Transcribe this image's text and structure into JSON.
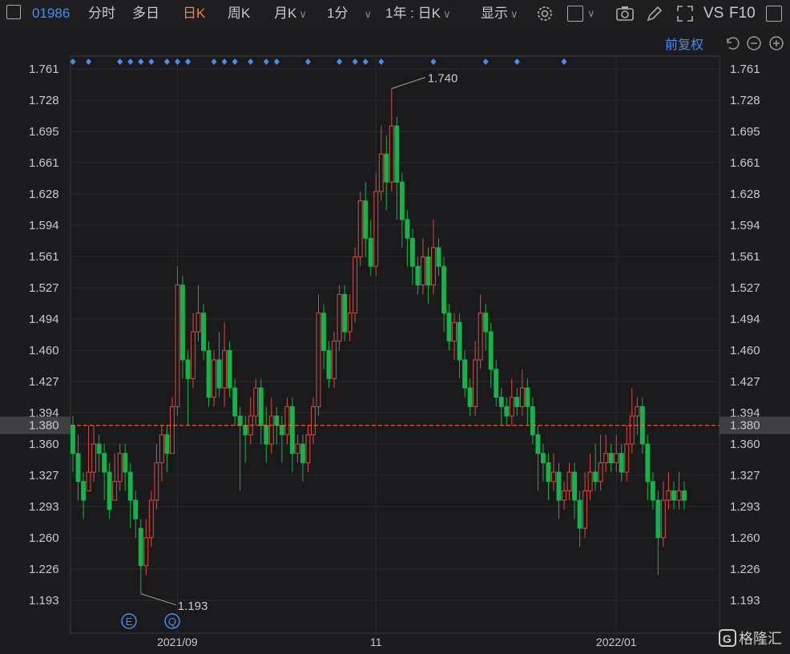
{
  "toolbar": {
    "code": "01986",
    "items": [
      "分时",
      "多日",
      "日K",
      "周K",
      "月K",
      "1分",
      "1年 : 日K",
      "显示"
    ],
    "active_item": "日K",
    "vs_label": "VS",
    "f10_label": "F10"
  },
  "adjust": {
    "label": "前复权"
  },
  "watermark": "格隆汇",
  "colors": {
    "up": "#e0493f",
    "down": "#16b24a",
    "marker": "#3f8dff",
    "current_price": "#ff5b4b",
    "accent": "#ff7a2e"
  },
  "event_markers": [
    "E",
    "Q"
  ],
  "chart_data": {
    "type": "candlestick",
    "y_ticks": [
      "1.761",
      "1.728",
      "1.695",
      "1.661",
      "1.628",
      "1.594",
      "1.561",
      "1.527",
      "1.494",
      "1.460",
      "1.427",
      "1.394",
      "1.360",
      "1.327",
      "1.293",
      "1.260",
      "1.226",
      "1.193"
    ],
    "ylim": [
      1.193,
      1.761
    ],
    "x_ticks": [
      "2021/09",
      "11",
      "2022/01"
    ],
    "current_price": "1.380",
    "max_label": "1.740",
    "min_label": "1.193",
    "candles": [
      [
        1.38,
        1.35,
        1.39,
        1.33
      ],
      [
        1.35,
        1.32,
        1.37,
        1.3
      ],
      [
        1.32,
        1.3,
        1.33,
        1.28
      ],
      [
        1.31,
        1.33,
        1.38,
        1.31
      ],
      [
        1.33,
        1.36,
        1.38,
        1.32
      ],
      [
        1.36,
        1.35,
        1.37,
        1.33
      ],
      [
        1.35,
        1.33,
        1.36,
        1.3
      ],
      [
        1.33,
        1.29,
        1.34,
        1.28
      ],
      [
        1.3,
        1.32,
        1.35,
        1.3
      ],
      [
        1.32,
        1.35,
        1.36,
        1.31
      ],
      [
        1.35,
        1.33,
        1.36,
        1.31
      ],
      [
        1.33,
        1.3,
        1.34,
        1.27
      ],
      [
        1.3,
        1.28,
        1.31,
        1.26
      ],
      [
        1.27,
        1.23,
        1.28,
        1.2
      ],
      [
        1.23,
        1.26,
        1.28,
        1.22
      ],
      [
        1.26,
        1.3,
        1.31,
        1.25
      ],
      [
        1.3,
        1.34,
        1.36,
        1.29
      ],
      [
        1.34,
        1.37,
        1.38,
        1.32
      ],
      [
        1.37,
        1.35,
        1.38,
        1.33
      ],
      [
        1.35,
        1.4,
        1.41,
        1.35
      ],
      [
        1.4,
        1.53,
        1.55,
        1.39
      ],
      [
        1.53,
        1.45,
        1.54,
        1.43
      ],
      [
        1.45,
        1.43,
        1.46,
        1.38
      ],
      [
        1.43,
        1.48,
        1.5,
        1.42
      ],
      [
        1.48,
        1.5,
        1.53,
        1.47
      ],
      [
        1.5,
        1.46,
        1.51,
        1.45
      ],
      [
        1.46,
        1.41,
        1.47,
        1.4
      ],
      [
        1.41,
        1.45,
        1.46,
        1.4
      ],
      [
        1.45,
        1.42,
        1.48,
        1.41
      ],
      [
        1.42,
        1.46,
        1.49,
        1.4
      ],
      [
        1.46,
        1.42,
        1.47,
        1.41
      ],
      [
        1.42,
        1.39,
        1.43,
        1.38
      ],
      [
        1.39,
        1.38,
        1.4,
        1.31
      ],
      [
        1.38,
        1.37,
        1.39,
        1.34
      ],
      [
        1.37,
        1.39,
        1.41,
        1.36
      ],
      [
        1.39,
        1.42,
        1.43,
        1.38
      ],
      [
        1.42,
        1.38,
        1.43,
        1.36
      ],
      [
        1.38,
        1.36,
        1.4,
        1.34
      ],
      [
        1.36,
        1.39,
        1.41,
        1.35
      ],
      [
        1.39,
        1.38,
        1.4,
        1.36
      ],
      [
        1.38,
        1.37,
        1.39,
        1.34
      ],
      [
        1.37,
        1.4,
        1.41,
        1.36
      ],
      [
        1.4,
        1.35,
        1.41,
        1.33
      ],
      [
        1.35,
        1.36,
        1.37,
        1.34
      ],
      [
        1.36,
        1.34,
        1.37,
        1.32
      ],
      [
        1.34,
        1.37,
        1.38,
        1.33
      ],
      [
        1.37,
        1.4,
        1.41,
        1.36
      ],
      [
        1.4,
        1.5,
        1.52,
        1.39
      ],
      [
        1.5,
        1.46,
        1.51,
        1.44
      ],
      [
        1.46,
        1.43,
        1.47,
        1.42
      ],
      [
        1.43,
        1.47,
        1.48,
        1.42
      ],
      [
        1.47,
        1.52,
        1.53,
        1.46
      ],
      [
        1.52,
        1.48,
        1.53,
        1.47
      ],
      [
        1.48,
        1.5,
        1.52,
        1.47
      ],
      [
        1.5,
        1.56,
        1.57,
        1.49
      ],
      [
        1.56,
        1.62,
        1.63,
        1.55
      ],
      [
        1.62,
        1.58,
        1.64,
        1.56
      ],
      [
        1.58,
        1.55,
        1.6,
        1.54
      ],
      [
        1.55,
        1.63,
        1.65,
        1.54
      ],
      [
        1.63,
        1.67,
        1.7,
        1.62
      ],
      [
        1.67,
        1.64,
        1.69,
        1.61
      ],
      [
        1.64,
        1.7,
        1.74,
        1.63
      ],
      [
        1.7,
        1.64,
        1.71,
        1.6
      ],
      [
        1.64,
        1.6,
        1.65,
        1.57
      ],
      [
        1.6,
        1.58,
        1.61,
        1.55
      ],
      [
        1.58,
        1.55,
        1.59,
        1.53
      ],
      [
        1.55,
        1.53,
        1.56,
        1.52
      ],
      [
        1.53,
        1.56,
        1.58,
        1.52
      ],
      [
        1.56,
        1.53,
        1.57,
        1.51
      ],
      [
        1.53,
        1.57,
        1.6,
        1.52
      ],
      [
        1.57,
        1.55,
        1.58,
        1.54
      ],
      [
        1.55,
        1.5,
        1.56,
        1.48
      ],
      [
        1.5,
        1.47,
        1.51,
        1.46
      ],
      [
        1.47,
        1.49,
        1.5,
        1.45
      ],
      [
        1.49,
        1.45,
        1.5,
        1.43
      ],
      [
        1.45,
        1.42,
        1.46,
        1.41
      ],
      [
        1.42,
        1.4,
        1.43,
        1.39
      ],
      [
        1.4,
        1.45,
        1.47,
        1.39
      ],
      [
        1.45,
        1.5,
        1.52,
        1.44
      ],
      [
        1.5,
        1.48,
        1.51,
        1.46
      ],
      [
        1.48,
        1.44,
        1.49,
        1.42
      ],
      [
        1.44,
        1.41,
        1.45,
        1.4
      ],
      [
        1.41,
        1.4,
        1.42,
        1.38
      ],
      [
        1.4,
        1.39,
        1.41,
        1.38
      ],
      [
        1.39,
        1.41,
        1.43,
        1.38
      ],
      [
        1.41,
        1.4,
        1.42,
        1.39
      ],
      [
        1.4,
        1.42,
        1.44,
        1.39
      ],
      [
        1.42,
        1.4,
        1.43,
        1.38
      ],
      [
        1.4,
        1.37,
        1.41,
        1.36
      ],
      [
        1.37,
        1.35,
        1.38,
        1.31
      ],
      [
        1.35,
        1.34,
        1.36,
        1.32
      ],
      [
        1.34,
        1.32,
        1.35,
        1.3
      ],
      [
        1.32,
        1.33,
        1.35,
        1.31
      ],
      [
        1.33,
        1.3,
        1.34,
        1.28
      ],
      [
        1.3,
        1.31,
        1.32,
        1.29
      ],
      [
        1.31,
        1.33,
        1.34,
        1.3
      ],
      [
        1.33,
        1.3,
        1.34,
        1.28
      ],
      [
        1.3,
        1.27,
        1.31,
        1.25
      ],
      [
        1.27,
        1.31,
        1.33,
        1.26
      ],
      [
        1.31,
        1.33,
        1.35,
        1.3
      ],
      [
        1.33,
        1.32,
        1.36,
        1.31
      ],
      [
        1.32,
        1.34,
        1.37,
        1.31
      ],
      [
        1.34,
        1.35,
        1.37,
        1.33
      ],
      [
        1.35,
        1.34,
        1.36,
        1.33
      ],
      [
        1.34,
        1.35,
        1.37,
        1.33
      ],
      [
        1.35,
        1.33,
        1.36,
        1.32
      ],
      [
        1.33,
        1.36,
        1.38,
        1.32
      ],
      [
        1.36,
        1.39,
        1.42,
        1.35
      ],
      [
        1.39,
        1.4,
        1.41,
        1.37
      ],
      [
        1.4,
        1.36,
        1.41,
        1.35
      ],
      [
        1.36,
        1.32,
        1.37,
        1.3
      ],
      [
        1.32,
        1.3,
        1.33,
        1.29
      ],
      [
        1.3,
        1.26,
        1.31,
        1.22
      ],
      [
        1.26,
        1.3,
        1.32,
        1.25
      ],
      [
        1.3,
        1.31,
        1.33,
        1.29
      ],
      [
        1.31,
        1.3,
        1.32,
        1.29
      ],
      [
        1.3,
        1.31,
        1.33,
        1.29
      ],
      [
        1.31,
        1.3,
        1.32,
        1.29
      ]
    ]
  }
}
